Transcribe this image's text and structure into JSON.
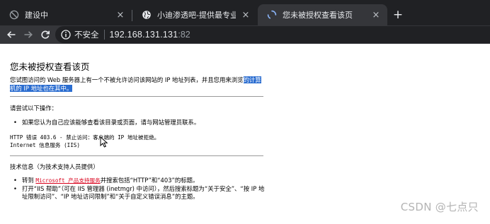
{
  "browser": {
    "tabs": [
      {
        "title": "建设中",
        "icon": "globe-crossed-icon",
        "active": false
      },
      {
        "title": "小迪渗透吧-提供最专业的渗透测",
        "icon": "globe-icon",
        "active": false
      },
      {
        "title": "您未被授权查看该页",
        "icon": "loading-spinner-icon",
        "active": true
      }
    ],
    "close_glyph": "×",
    "new_tab_glyph": "+",
    "address": {
      "security_text": "不安全",
      "host": "192.168.131.131",
      "port": ":82"
    }
  },
  "error_page": {
    "title": "您未被授权查看该页",
    "intro_pre": "您试图访问的 Web 服务器上有一个不被允许访问该网站的 IP 地址列表，并且您用来浏览",
    "intro_highlight": "的计算机的 IP 地址也在其中。",
    "try_heading": "请尝试以下操作：",
    "try_items": [
      "如果您认为自己应该能够查看该目录或页面，请与网站管理员联系。"
    ],
    "error_line": "HTTP 错误 403.6 - 禁止访问：客户端的 IP 地址被拒绝。",
    "service_line": "Internet 信息服务 (IIS)",
    "tech_heading": "技术信息（为技术支持人员提供）",
    "tech_item1_pre": "转到 ",
    "tech_item1_link": "Microsoft 产品支持服务",
    "tech_item1_post": "并搜索包括“HTTP”和“403”的标题。",
    "tech_item2": "打开“IIS 帮助”（可在 IIS 管理器 (inetmgr) 中访问），然后搜索标题为“关于安全”、“按 IP 地址限制访问”、“IP 地址访问限制”和“关于自定义错误消息”的主题。"
  },
  "watermark": "CSDN @七点只"
}
